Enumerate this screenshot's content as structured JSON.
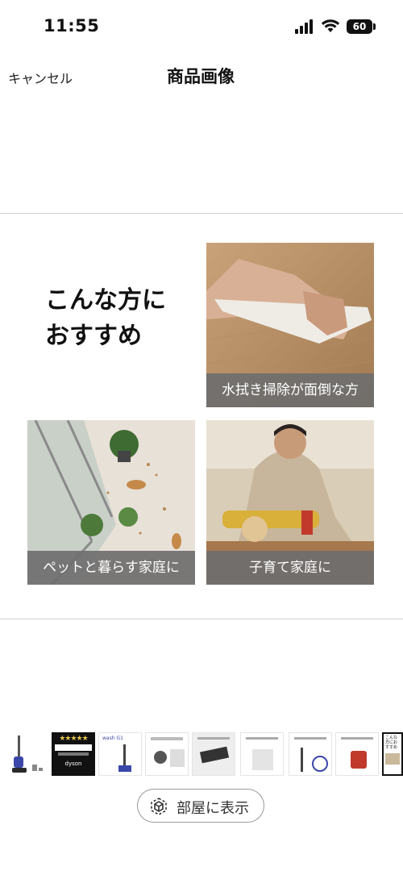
{
  "status_bar": {
    "time": "11:55",
    "battery": "60"
  },
  "nav": {
    "cancel_label": "キャンセル",
    "title": "商品画像"
  },
  "hero": {
    "title_line1": "こんな方に",
    "title_line2": "おすすめ",
    "cards": [
      {
        "label": "水拭き掃除が面倒な方"
      },
      {
        "label": "ペットと暮らす家庭に"
      },
      {
        "label": "子育て家庭に"
      }
    ]
  },
  "thumbnails": {
    "items": [
      {
        "icon": "vacuum-product"
      },
      {
        "text": "dyson"
      },
      {
        "text": "wash G1"
      },
      {
        "text": ""
      },
      {
        "text": ""
      },
      {
        "text": ""
      },
      {
        "text": ""
      },
      {
        "text": ""
      },
      {
        "text": ""
      },
      {
        "text": "こんな方におすすめ"
      }
    ]
  },
  "ar_button": {
    "label": "部屋に表示",
    "icon": "ar-cube-icon"
  }
}
